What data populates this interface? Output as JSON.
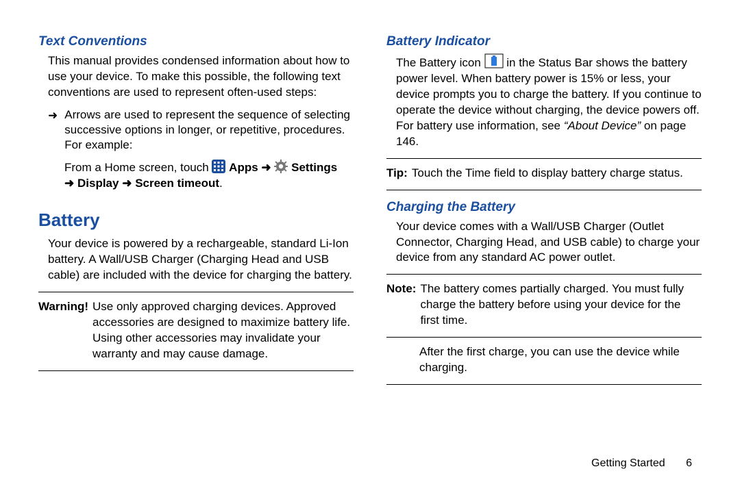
{
  "left": {
    "h_text_conventions": "Text Conventions",
    "p1": "This manual provides condensed information about how to use your device. To make this possible, the following text conventions are used to represent often-used steps:",
    "bullet_text": "Arrows are used to represent the sequence of selecting successive options in longer, or repetitive, procedures. For example:",
    "example_prefix": "From a Home screen, touch",
    "apps_label": "Apps",
    "settings_label": "Settings",
    "display_label": "Display",
    "screen_timeout_label": "Screen timeout",
    "h_battery": "Battery",
    "p_battery": "Your device is powered by a rechargeable, standard Li-Ion battery. A Wall/USB Charger (Charging Head and USB cable) are included with the device for charging the battery.",
    "warning_label": "Warning!",
    "warning_body": "Use only approved charging devices. Approved accessories are designed to maximize battery life. Using other accessories may invalidate your warranty and may cause damage."
  },
  "right": {
    "h_indicator": "Battery Indicator",
    "ind_prefix": "The Battery icon",
    "ind_suffix1": "in the Status Bar shows the battery power level. When battery power is 15% or less, your device prompts you to charge the battery. If you continue to operate the device without charging, the device powers off. For battery use information, see ",
    "ind_ref_italic": "“About Device”",
    "ind_ref_tail": " on page 146.",
    "tip_label": "Tip:",
    "tip_body": "Touch the Time field to display battery charge status.",
    "h_charging": "Charging the Battery",
    "p_charging": "Your device comes with a Wall/USB Charger (Outlet Connector, Charging Head, and USB cable) to charge your device from any standard AC power outlet.",
    "note_label": "Note:",
    "note_body": "The battery comes partially charged. You must fully charge the battery before using your device for the first time.",
    "p_after": "After the first charge, you can use the device while charging."
  },
  "footer": {
    "section": "Getting Started",
    "page": "6"
  },
  "glyphs": {
    "arrow": "➜"
  }
}
